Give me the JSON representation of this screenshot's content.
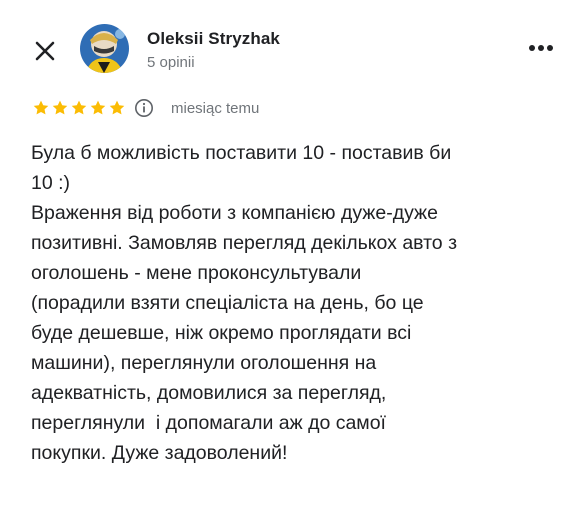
{
  "reviewer": {
    "name": "Oleksii Stryzhak",
    "reviews_count": "5 opinii"
  },
  "rating": {
    "stars": 5,
    "max": 5,
    "time_ago": "miesiąc temu"
  },
  "review_lines": [
    "Була б можливість поставити 10 - поставив би",
    "10 :)",
    "Враження від роботи з компанією дуже-дуже",
    "позитивні. Замовляв перегляд декількох авто з",
    "оголошень - мене проконсультували",
    "(порадили взяти спеціаліста на день, бо це",
    "буде дешевше, ніж окремо проглядати всі",
    "машини), переглянули оголошення на",
    "адекватність, домовилися за перегляд,",
    "переглянули  і допомагали аж до самої",
    "покупки. Дуже задоволений!"
  ],
  "icons": {
    "close": "close-icon",
    "more": "more-horizontal-icon",
    "info": "info-icon",
    "star": "star-icon"
  },
  "colors": {
    "star": "#fbbc04",
    "muted": "#70757a",
    "text": "#202124"
  }
}
